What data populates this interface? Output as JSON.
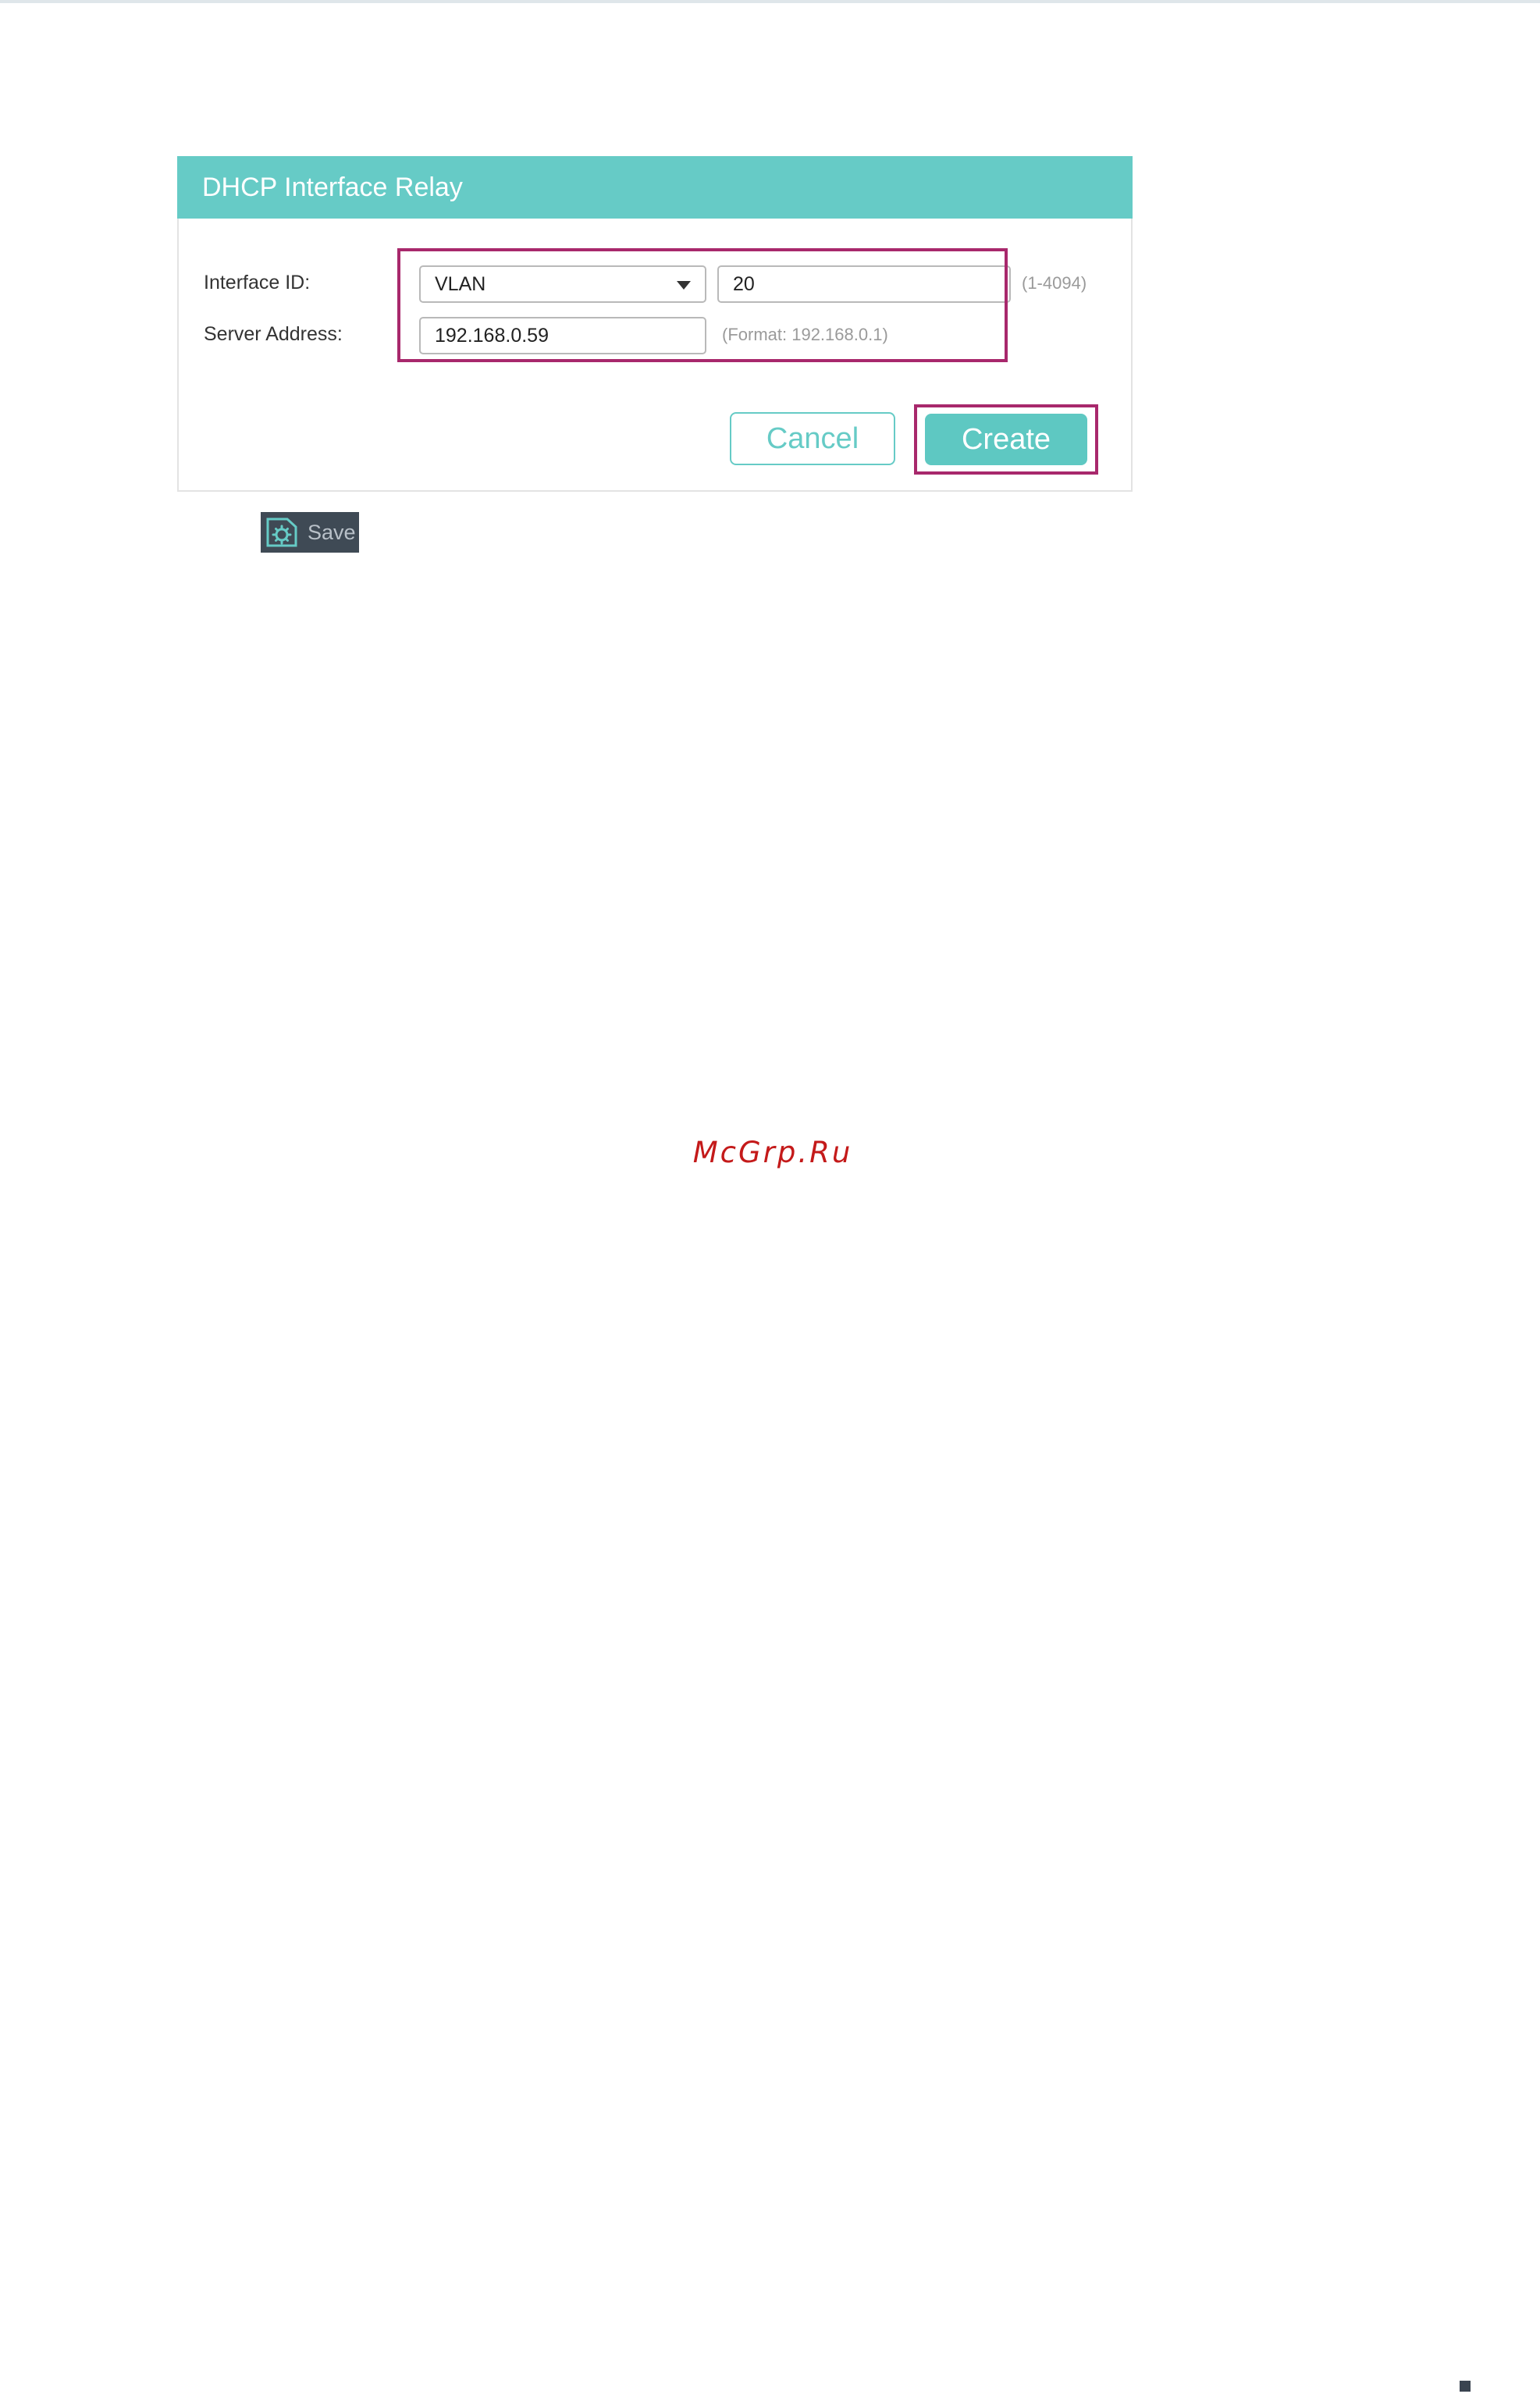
{
  "panel": {
    "title": "DHCP Interface Relay",
    "interface_id": {
      "label": "Interface ID:",
      "type_value": "VLAN",
      "id_value": "20",
      "range_hint": "(1-4094)"
    },
    "server_address": {
      "label": "Server Address:",
      "value": "192.168.0.59",
      "format_hint": "(Format: 192.168.0.1)"
    },
    "buttons": {
      "cancel": "Cancel",
      "create": "Create"
    }
  },
  "toolbar": {
    "save_label": "Save"
  },
  "watermark": "McGrp.Ru",
  "colors": {
    "accent": "#66cbc6",
    "highlight": "#a8286c",
    "save_bg": "#3f4a55"
  }
}
